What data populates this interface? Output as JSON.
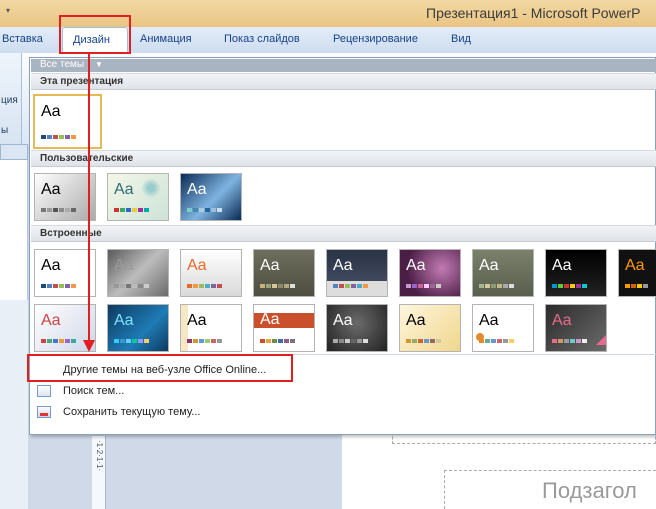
{
  "window": {
    "title": "Презентация1 - Microsoft PowerP"
  },
  "ribbon": {
    "tabs": [
      "Вставка",
      "Дизайн",
      "Анимация",
      "Показ слайдов",
      "Рецензирование",
      "Вид"
    ],
    "left_fragments": [
      "ция",
      "ы"
    ]
  },
  "gallery": {
    "filter_label": "Все темы",
    "sections": {
      "this_presentation": "Эта презентация",
      "custom": "Пользовательские",
      "builtin": "Встроенные"
    },
    "theme_label": "Aa",
    "menu": {
      "more_online": "Другие темы на веб-узле Office Online...",
      "browse": "Поиск тем...",
      "save_current": "Сохранить текущую тему..."
    }
  },
  "slide": {
    "subtitle_placeholder": "Подзагол",
    "ruler_text": "·1·2·1·1·"
  },
  "colors": {
    "highlight": "#e02020",
    "ribbon_blue": "#15428b",
    "title_bar": "#f3d8a4",
    "selection": "#e8b957"
  }
}
